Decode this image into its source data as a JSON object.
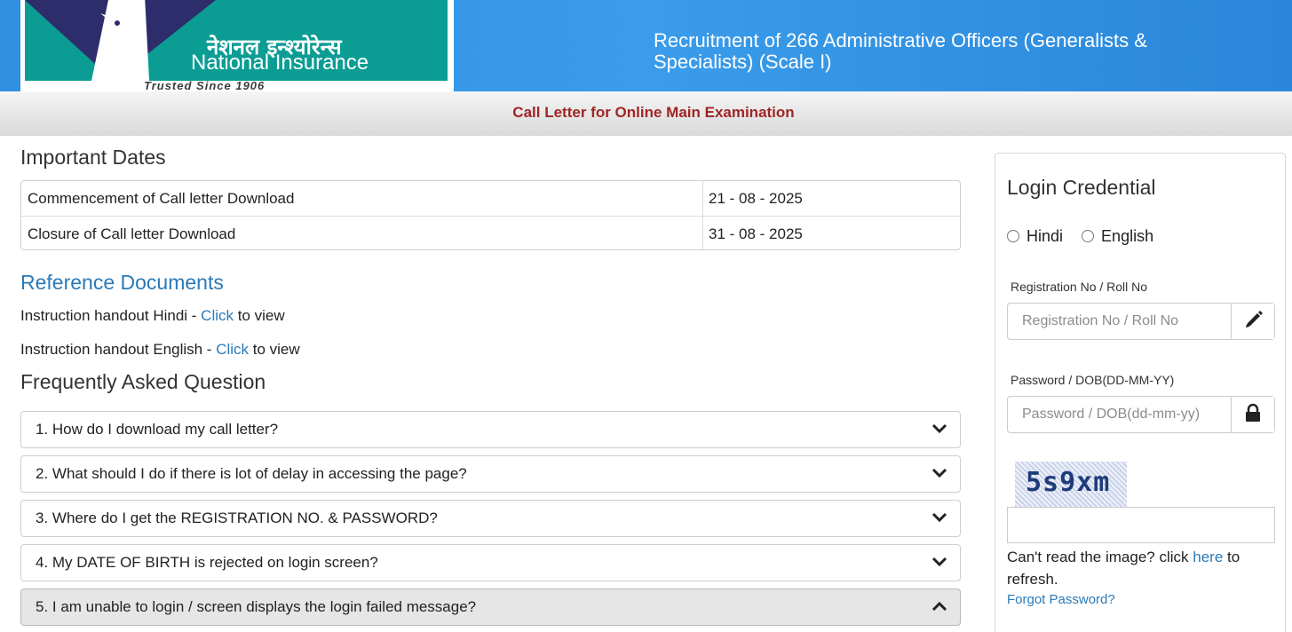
{
  "header": {
    "logo": {
      "hindi": "नेशनल इन्श्योरेन्स",
      "english": "National Insurance",
      "tagline": "Trusted Since 1906"
    },
    "title": "Recruitment of 266 Administrative Officers (Generalists & Specialists) (Scale I)"
  },
  "subbar": {
    "title": "Call Letter for Online Main Examination"
  },
  "important_dates": {
    "heading": "Important Dates",
    "rows": [
      {
        "label": "Commencement of Call letter Download",
        "date": "21 - 08 - 2025"
      },
      {
        "label": "Closure of Call letter Download",
        "date": "31 - 08 - 2025"
      }
    ]
  },
  "reference": {
    "heading": "Reference Documents",
    "items": [
      {
        "prefix": "Instruction handout Hindi - ",
        "link": "Click",
        "suffix": " to view"
      },
      {
        "prefix": "Instruction handout English - ",
        "link": "Click",
        "suffix": " to view"
      }
    ]
  },
  "faq": {
    "heading": "Frequently Asked Question",
    "items": [
      {
        "question": "1. How do I download my call letter?",
        "icon": "chevron-down-icon"
      },
      {
        "question": "2. What should I do if there is lot of delay in accessing the page?",
        "icon": "chevron-down-icon"
      },
      {
        "question": "3. Where do I get the REGISTRATION NO. & PASSWORD?",
        "icon": "chevron-down-icon"
      },
      {
        "question": "4. My DATE OF BIRTH is rejected on login screen?",
        "icon": "chevron-down-icon"
      },
      {
        "question": "5. I am unable to login / screen displays the login failed message?",
        "icon": "chevron-up-icon"
      }
    ]
  },
  "login": {
    "title": "Login Credential",
    "language_options": [
      "Hindi",
      "English"
    ],
    "registration": {
      "label": "Registration No / Roll No",
      "placeholder": "Registration No / Roll No",
      "icon": "pencil-icon"
    },
    "password": {
      "label": "Password / DOB(DD-MM-YY)",
      "placeholder": "Password / DOB(dd-mm-yy)",
      "icon": "lock-icon"
    },
    "captcha": {
      "text": "5s9xm",
      "help_prefix": "Can't read the image? click ",
      "help_link": "here",
      "help_suffix": " to refresh."
    },
    "forgot_password": "Forgot Password?"
  },
  "colors": {
    "header_blue": "#3a9cea",
    "logo_teal": "#0b9d94",
    "subtitle_red": "#a12525",
    "link_blue": "#2a7ab8"
  }
}
